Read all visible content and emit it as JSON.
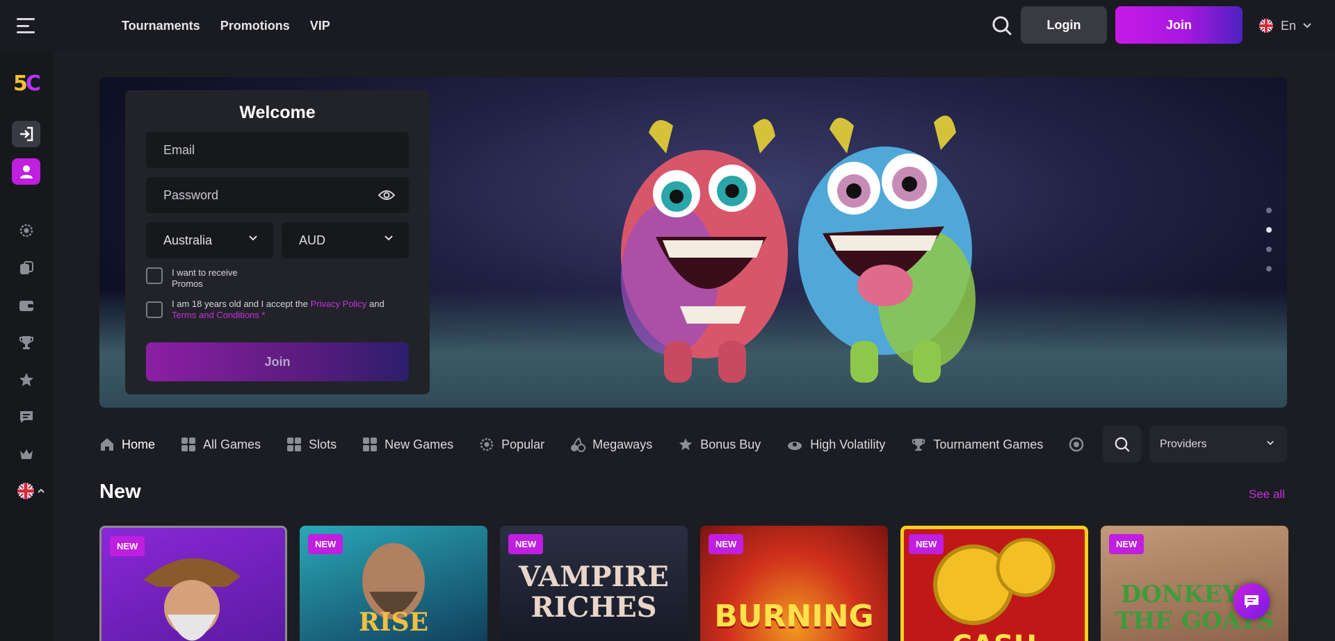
{
  "header": {
    "nav": [
      "Tournaments",
      "Promotions",
      "VIP"
    ],
    "login_label": "Login",
    "join_label": "Join",
    "language": "En"
  },
  "sidebar": {
    "logo_text": "5C",
    "icons": [
      "login-icon",
      "profile-icon",
      "popular-icon",
      "slots-icon",
      "wallet-icon",
      "trophy-icon",
      "star-icon",
      "chat-icon",
      "crown-icon",
      "uk-flag-icon"
    ]
  },
  "welcome_form": {
    "title": "Welcome",
    "email_placeholder": "Email",
    "password_placeholder": "Password",
    "country": "Australia",
    "currency": "AUD",
    "promos_label_1": "I want to receive",
    "promos_label_2": "Promos",
    "terms_prefix": "I am 18 years old and I accept the ",
    "privacy_link": "Privacy Policy",
    "terms_and": " and",
    "terms_link": "Terms and Conditions",
    "required_mark": " *",
    "join_label": "Join"
  },
  "banner": {
    "slides_total": 4,
    "active_slide": 2
  },
  "categories": [
    {
      "label": "Home",
      "icon": "home-icon",
      "active": true
    },
    {
      "label": "All Games",
      "icon": "grid-icon"
    },
    {
      "label": "Slots",
      "icon": "grid-icon"
    },
    {
      "label": "New Games",
      "icon": "grid-icon"
    },
    {
      "label": "Popular",
      "icon": "gear-icon"
    },
    {
      "label": "Megaways",
      "icon": "cherry-icon"
    },
    {
      "label": "Bonus Buy",
      "icon": "star-icon"
    },
    {
      "label": "High Volatility",
      "icon": "volatility-icon"
    },
    {
      "label": "Tournament Games",
      "icon": "trophy-icon"
    }
  ],
  "providers_label": "Providers",
  "new_section": {
    "title": "New",
    "see_all": "See all",
    "badge": "NEW",
    "games": [
      {
        "title": "",
        "colors": [
          "#8a28d8",
          "#5a1aa0"
        ]
      },
      {
        "title": "RISE",
        "colors": [
          "#2aa8b8",
          "#103a58"
        ]
      },
      {
        "title": "VAMPIRE RICHES",
        "colors": [
          "#2a2f42",
          "#151824"
        ]
      },
      {
        "title": "BURNING",
        "colors": [
          "#d0301c",
          "#7a1410"
        ]
      },
      {
        "title": "CASH",
        "colors": [
          "#e8c218",
          "#c01818"
        ]
      },
      {
        "title": "DONKEY & THE GOATS",
        "colors": [
          "#c29a78",
          "#8a6048"
        ]
      }
    ]
  },
  "colors": {
    "accent": "#c01ee0",
    "background": "#1c1d22",
    "panel": "#222328"
  }
}
